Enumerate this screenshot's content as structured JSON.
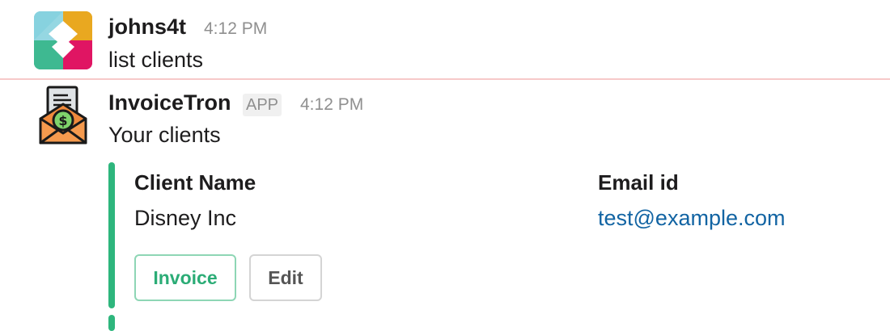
{
  "messages": [
    {
      "user": "johns4t",
      "time": "4:12 PM",
      "text": "list clients"
    },
    {
      "user": "InvoiceTron",
      "badge": "APP",
      "time": "4:12 PM",
      "text": "Your clients"
    }
  ],
  "attachment": {
    "accent_color": "#2eb67d",
    "fields": [
      {
        "title": "Client Name",
        "value": "Disney Inc"
      },
      {
        "title": "Email id",
        "value": "test@example.com"
      }
    ],
    "buttons": {
      "invoice_label": "Invoice",
      "edit_label": "Edit"
    }
  },
  "icons": {
    "user_avatar": "slack-logo-avatar",
    "app_avatar": "invoice-envelope-icon"
  },
  "colors": {
    "link": "#1264a3",
    "primary_button": "#2bac76",
    "new_message_divider": "#f7c9c9"
  }
}
